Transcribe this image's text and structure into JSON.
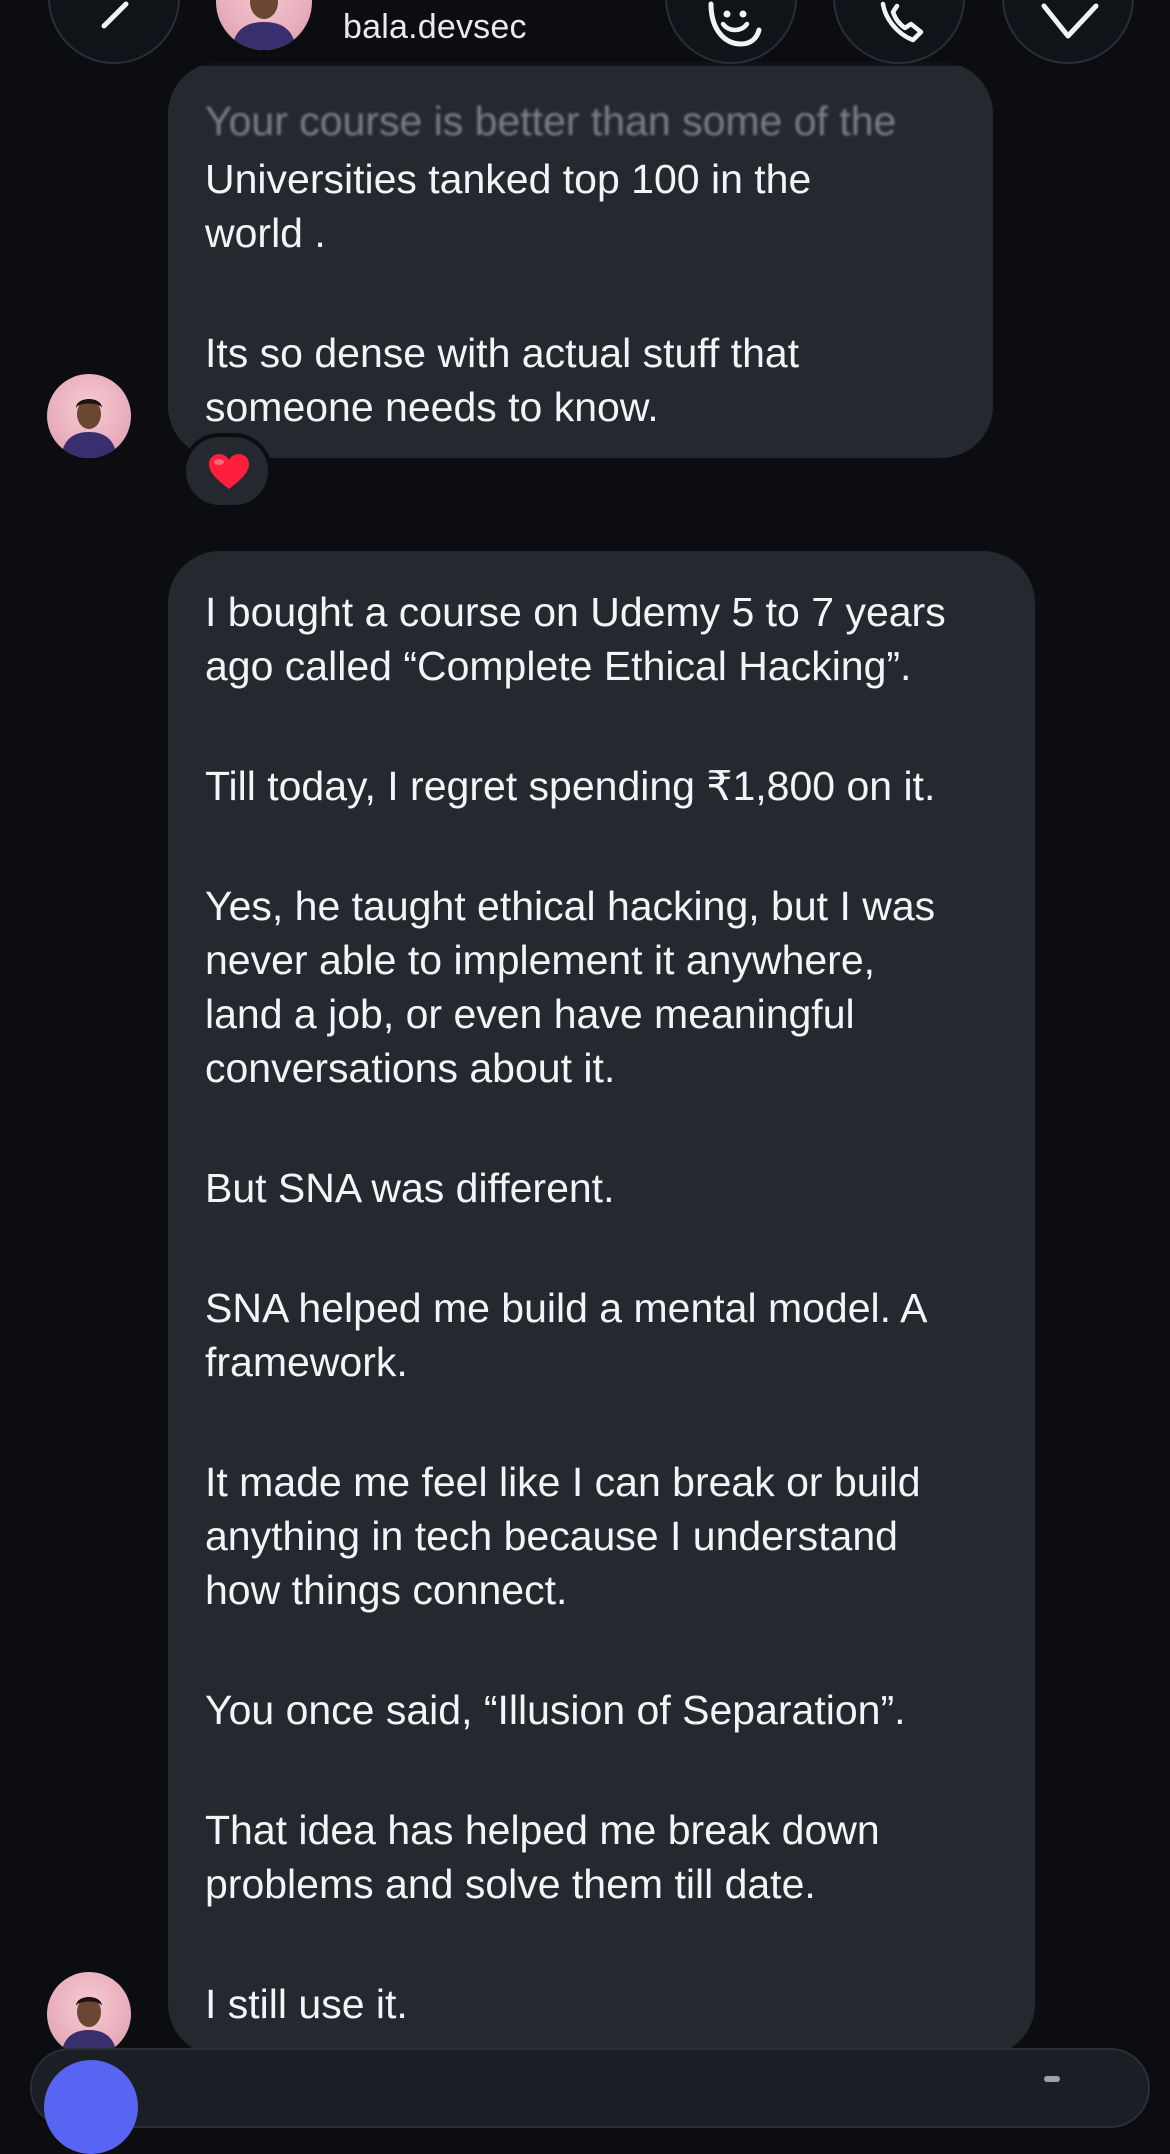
{
  "header": {
    "username": "bala.devsec",
    "icons": {
      "back": "chevron-left-icon",
      "effects": "sticker-face-icon",
      "call": "phone-icon",
      "tag": "tag-icon"
    }
  },
  "messages": [
    {
      "faded_line": "Your course is better than some of the",
      "paragraphs": [
        "Universities tanked top 100 in the\nworld .",
        "Its so dense with actual stuff that\nsomeone needs to know."
      ],
      "reaction": "heart"
    },
    {
      "paragraphs": [
        "I bought a course on Udemy 5 to 7 years\nago called “Complete Ethical Hacking”.",
        "Till today, I regret spending ₹1,800 on it.",
        "Yes, he taught ethical hacking, but I was\nnever able to implement it anywhere,\nland a job, or even have meaningful\nconversations about it.",
        "But SNA was different.",
        "SNA helped me build a mental model. A\nframework.",
        "It made me feel like I can break or build\nanything in tech because I understand\nhow things connect.",
        "You once said, “Illusion of Separation”.",
        "That idea has helped me break down\nproblems and solve them till date.",
        "I still use it."
      ]
    }
  ],
  "colors": {
    "background": "#0b0d11",
    "bubble": "#25282e",
    "text": "#f3f4f6",
    "camera_button": "#5865f2",
    "reaction_heart": "#ff1f3d"
  }
}
